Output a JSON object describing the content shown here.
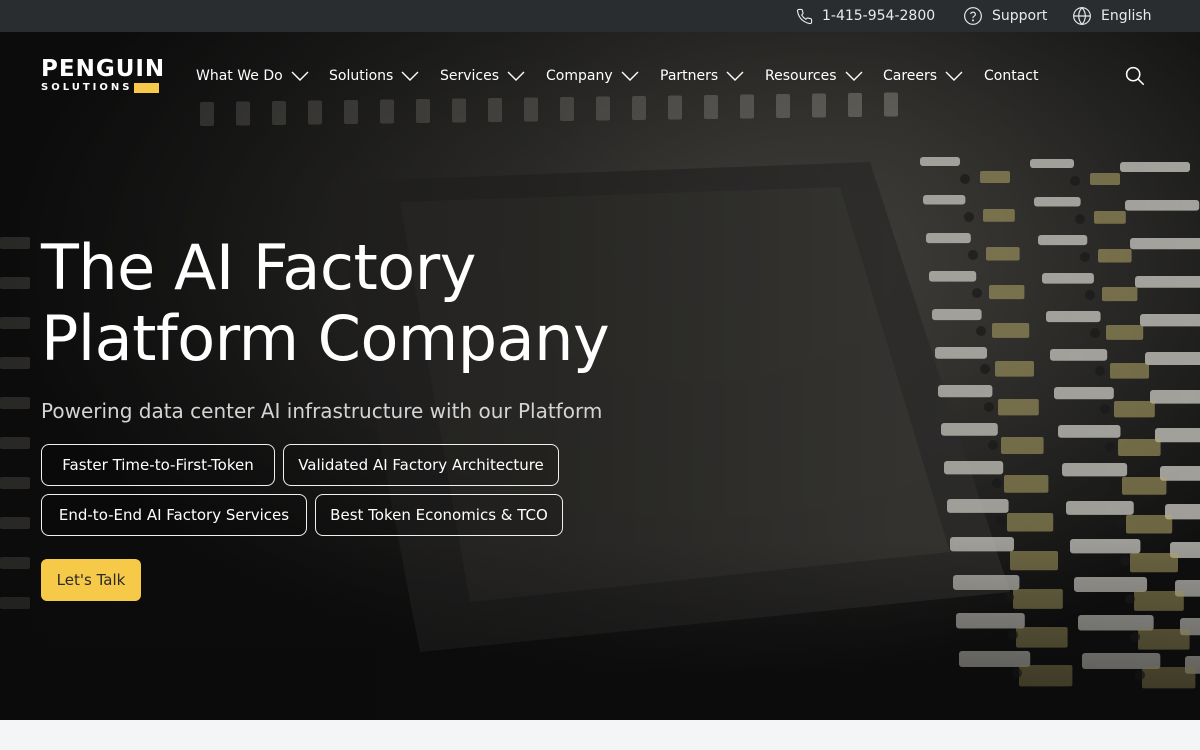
{
  "utility": {
    "phone": "1-415-954-2800",
    "support": "Support",
    "language": "English"
  },
  "brand": {
    "name_line1": "PENGUIN",
    "name_line2": "SOLUTIONS",
    "accent": "#f7c948"
  },
  "nav": {
    "items": [
      {
        "label": "What We Do",
        "has_menu": true
      },
      {
        "label": "Solutions",
        "has_menu": true
      },
      {
        "label": "Services",
        "has_menu": true
      },
      {
        "label": "Company",
        "has_menu": true
      },
      {
        "label": "Partners",
        "has_menu": true
      },
      {
        "label": "Resources",
        "has_menu": true
      },
      {
        "label": "Careers",
        "has_menu": true
      },
      {
        "label": "Contact",
        "has_menu": false
      }
    ],
    "search_icon": "search-icon"
  },
  "hero": {
    "headline_line1": "The AI Factory",
    "headline_line2": "Platform Company",
    "subhead": "Powering data center AI infrastructure with our Platform",
    "pills": [
      "Faster Time-to-First-Token",
      "Validated AI Factory Architecture",
      "End-to-End AI Factory Services",
      "Best Token Economics & TCO"
    ],
    "cta": "Let's Talk"
  },
  "colors": {
    "topbar": "#2a2d30",
    "cta": "#f7c948",
    "page_bg": "#f4f5f7"
  }
}
